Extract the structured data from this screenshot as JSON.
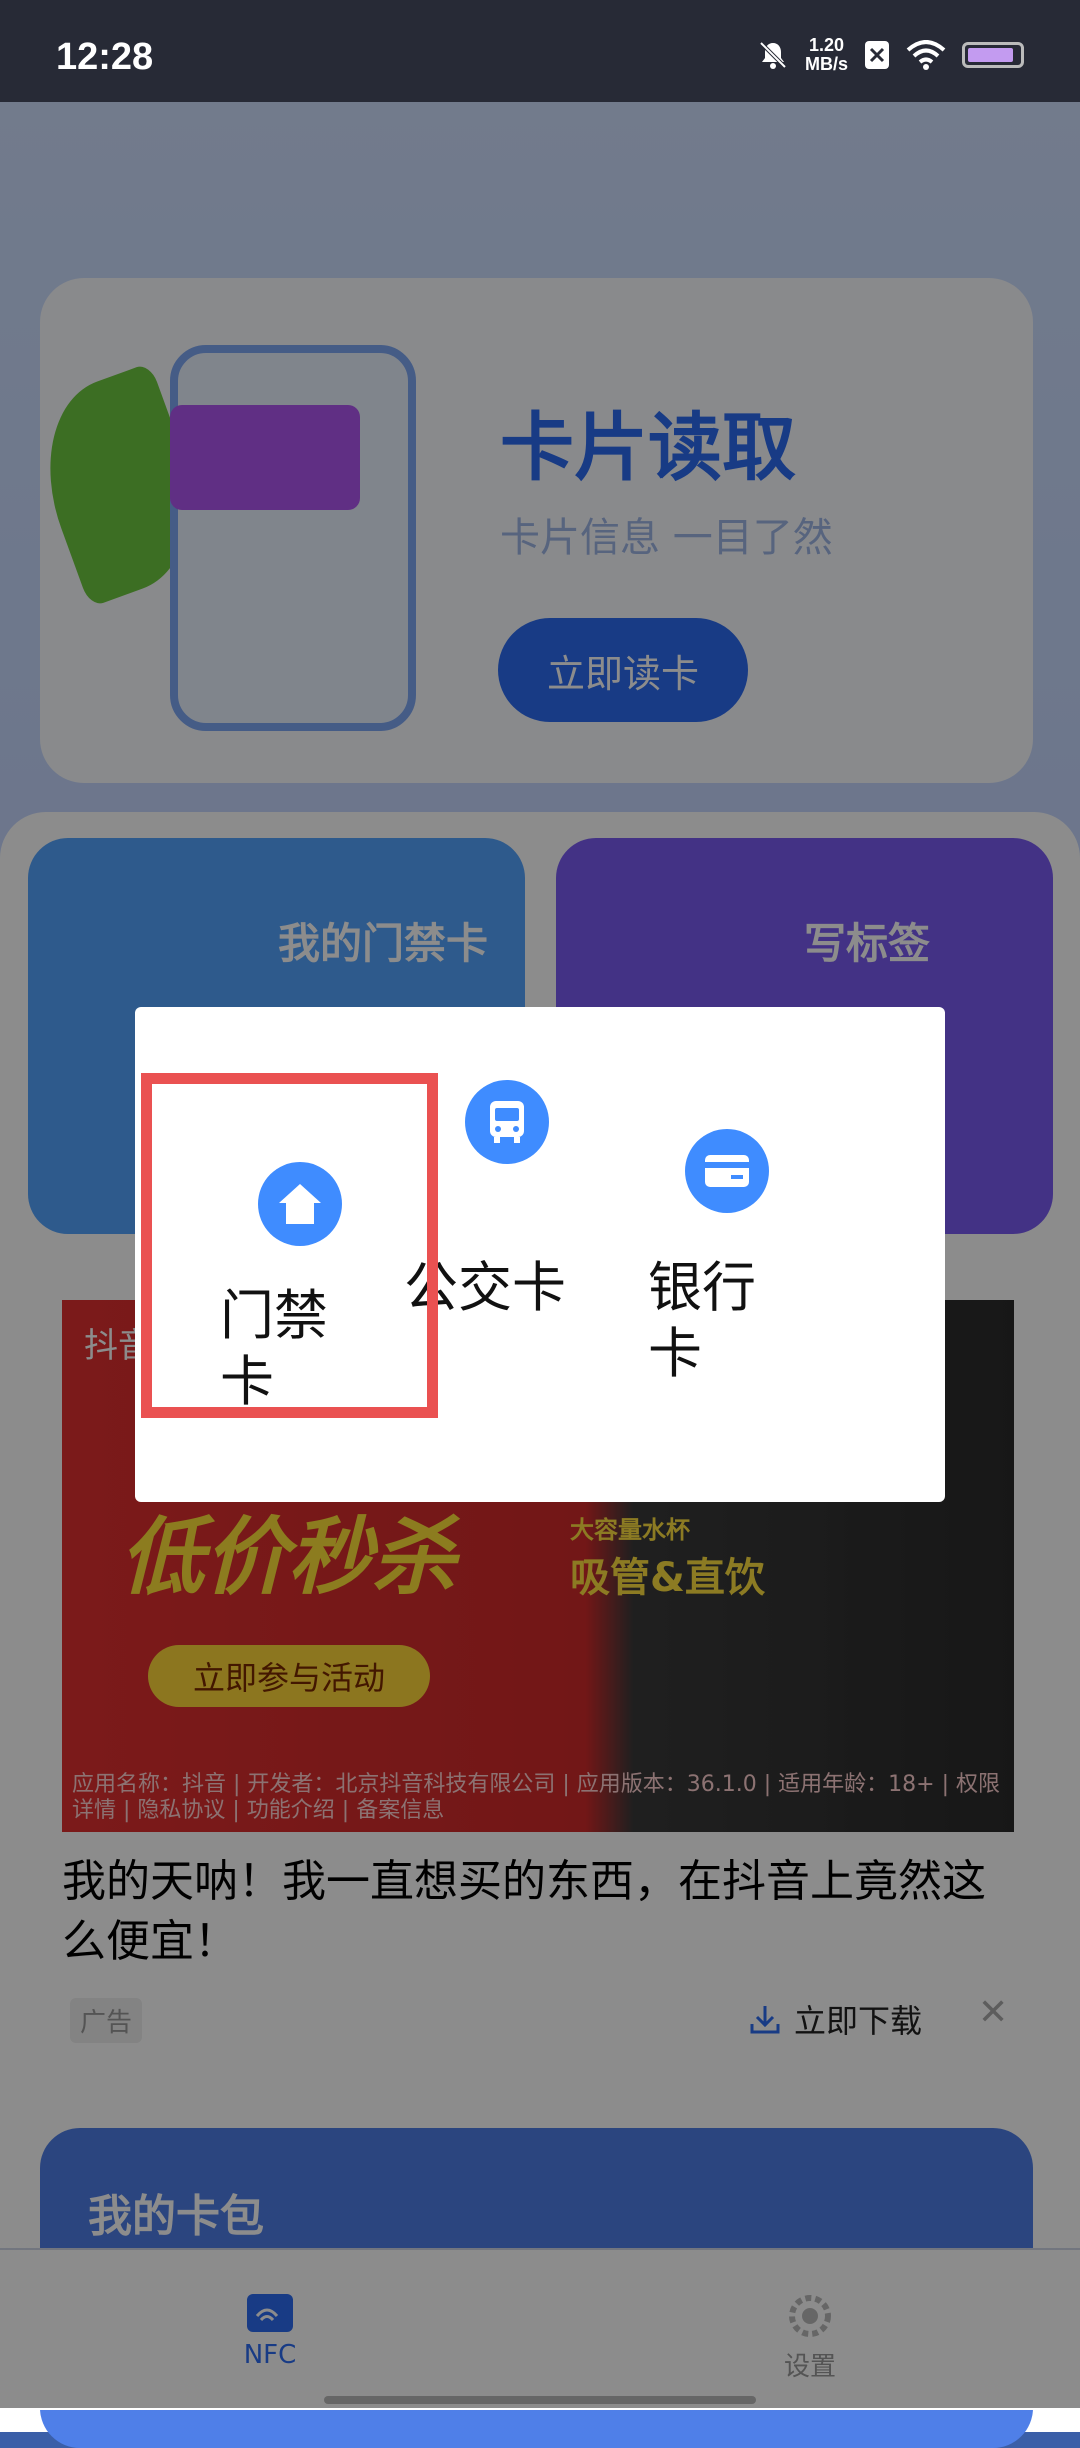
{
  "status_bar": {
    "time": "12:28",
    "net_speed_value": "1.20",
    "net_speed_unit": "MB/s",
    "icons": [
      "bell-mute-icon",
      "sim-icon",
      "wifi-icon",
      "battery-icon"
    ]
  },
  "hero": {
    "title": "卡片读取",
    "subtitle": "卡片信息 一目了然",
    "button": "立即读卡"
  },
  "tiles": {
    "access_card": "我的门禁卡",
    "write_tag": "写标签"
  },
  "ad": {
    "logo_text": "抖音",
    "big_text": "低价秒杀",
    "cta_pill": "立即参与活动",
    "tag_small": "大容量水杯",
    "tag_large": "吸管&直饮",
    "disclaimer": "应用名称：抖音 | 开发者：北京抖音科技有限公司 | 应用版本：36.1.0 | 适用年龄：18+ | 权限详情 | 隐私协议 | 功能介绍 | 备案信息",
    "headline": "我的天呐！我一直想买的东西，在抖音上竟然这么便宜！",
    "label": "广告",
    "download": "立即下载"
  },
  "wallet": {
    "title": "我的卡包"
  },
  "tabs": {
    "nfc": "NFC",
    "settings": "设置"
  },
  "dialog": {
    "options": [
      {
        "label": "门禁卡",
        "icon": "home-icon"
      },
      {
        "label": "公交卡",
        "icon": "bus-icon"
      },
      {
        "label": "银行卡",
        "icon": "credit-card-icon"
      }
    ],
    "highlight_color": "#ea5151",
    "icon_color": "#3f8cff"
  }
}
